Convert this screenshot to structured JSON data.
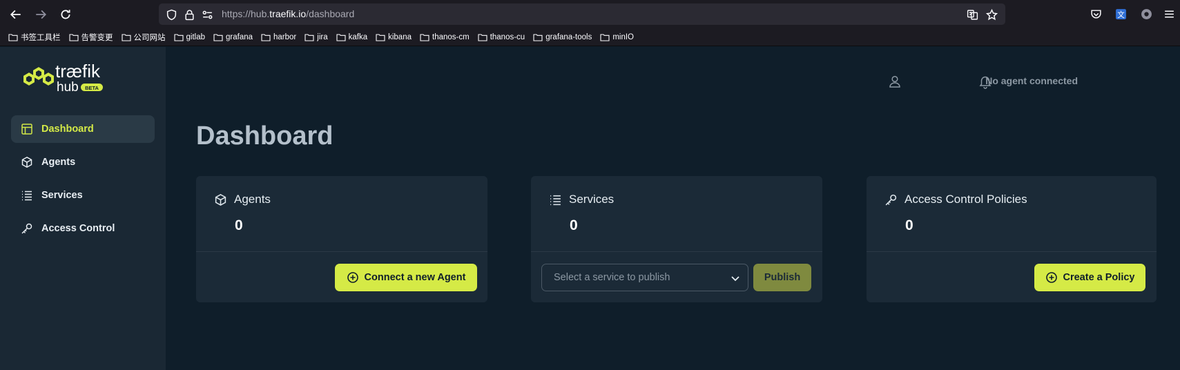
{
  "browser": {
    "url_prefix": "https://hub.",
    "url_domain": "traefik.io",
    "url_path": "/dashboard",
    "bookmarks": [
      "书签工具栏",
      "告警变更",
      "公司网站",
      "gitlab",
      "grafana",
      "harbor",
      "jira",
      "kafka",
      "kibana",
      "thanos-cm",
      "thanos-cu",
      "grafana-tools",
      "minIO"
    ]
  },
  "brand": {
    "name": "træfik",
    "sub": "hub",
    "badge": "BETA",
    "accent": "#d5ea46"
  },
  "sidebar": {
    "items": [
      {
        "label": "Dashboard",
        "icon": "layout-icon",
        "active": true
      },
      {
        "label": "Agents",
        "icon": "cube-icon"
      },
      {
        "label": "Services",
        "icon": "list-icon"
      },
      {
        "label": "Access Control",
        "icon": "key-icon"
      }
    ]
  },
  "header": {
    "status": "No agent connected",
    "title": "Dashboard"
  },
  "cards": {
    "agents": {
      "title": "Agents",
      "count": "0",
      "button": "Connect a new Agent"
    },
    "services": {
      "title": "Services",
      "count": "0",
      "select_placeholder": "Select a service to publish",
      "button": "Publish"
    },
    "access": {
      "title": "Access Control Policies",
      "count": "0",
      "button": "Create a Policy"
    }
  }
}
